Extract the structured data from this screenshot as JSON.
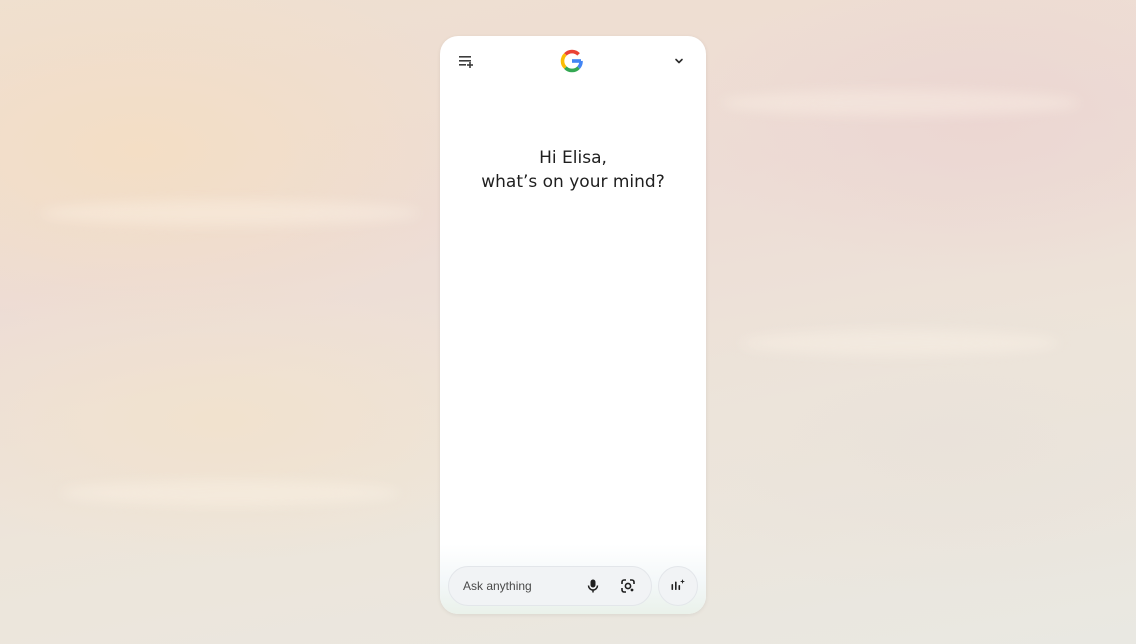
{
  "header": {
    "history_icon": "history-add-icon",
    "logo_icon": "google-g-logo",
    "expand_icon": "chevron-down-icon"
  },
  "greeting": {
    "line1": "Hi Elisa,",
    "line2": "what’s on your mind?"
  },
  "composer": {
    "placeholder": "Ask anything",
    "value": "",
    "mic_icon": "microphone-icon",
    "lens_icon": "google-lens-icon",
    "live_icon": "gemini-live-icon"
  },
  "colors": {
    "text": "#1f1f1f",
    "google_blue": "#4285F4",
    "google_red": "#EA4335",
    "google_yellow": "#FBBC05",
    "google_green": "#34A853",
    "pill_background": "#f1f3f5"
  }
}
